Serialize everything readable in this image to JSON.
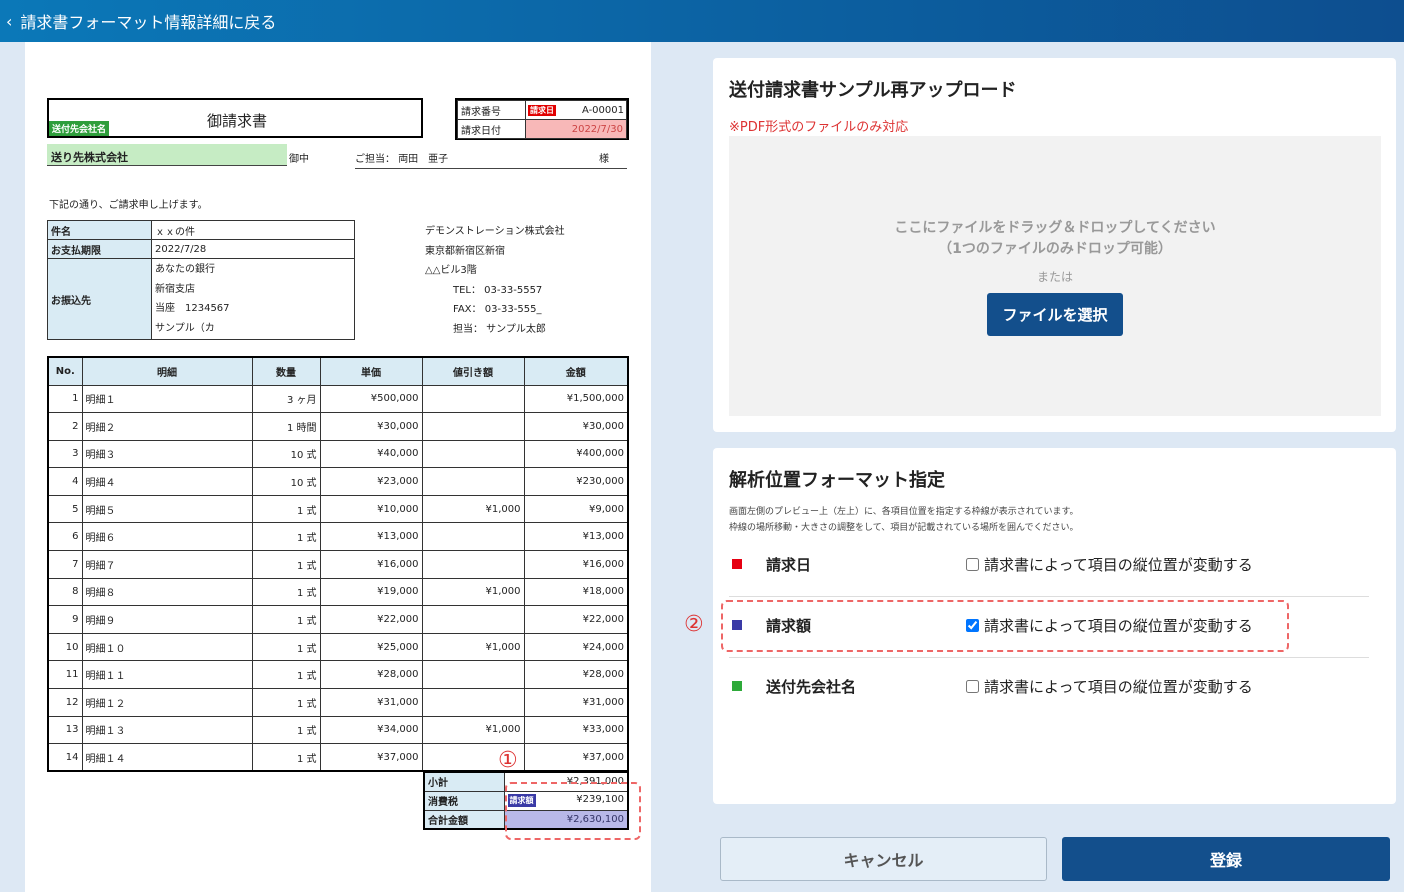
{
  "topbar": {
    "back_icon": "‹",
    "back_label": "請求書フォーマット情報詳細に戻る"
  },
  "invoice": {
    "title": "御請求書",
    "recipient_tag": "送付先会社名",
    "recipient": "送り先株式会社",
    "onchu": "御中",
    "tanto_label": "ご担当：",
    "tanto_name": "両田　亜子",
    "sama": "様",
    "meta": [
      {
        "label": "請求番号",
        "tag": "請求日",
        "value": "A-00001"
      },
      {
        "label": "請求日付",
        "value": "2022/7/30"
      }
    ],
    "greeting": "下記の通り、ご請求申し上げます。",
    "info": {
      "kenmei_label": "件名",
      "kenmei": "ｘｘの件",
      "due_label": "お支払期限",
      "due": "2022/7/28",
      "bank_label": "お振込先",
      "bank_lines": [
        "あなたの銀行",
        "新宿支店",
        "当座　1234567",
        "サンプル（カ"
      ]
    },
    "company": [
      "デモンストレーション株式会社",
      "東京都新宿区新宿",
      "△△ビル3階",
      "TEL：  03-33-5557",
      "FAX：  03-33-555_",
      "担当：  サンプル太郎"
    ],
    "headers": [
      "No.",
      "明細",
      "数量",
      "単価",
      "値引き額",
      "金額"
    ],
    "rows": [
      [
        "1",
        "明細１",
        "3 ヶ月",
        "¥500,000",
        "",
        "¥1,500,000"
      ],
      [
        "2",
        "明細２",
        "1 時間",
        "¥30,000",
        "",
        "¥30,000"
      ],
      [
        "3",
        "明細３",
        "10 式",
        "¥40,000",
        "",
        "¥400,000"
      ],
      [
        "4",
        "明細４",
        "10 式",
        "¥23,000",
        "",
        "¥230,000"
      ],
      [
        "5",
        "明細５",
        "1 式",
        "¥10,000",
        "¥1,000",
        "¥9,000"
      ],
      [
        "6",
        "明細６",
        "1 式",
        "¥13,000",
        "",
        "¥13,000"
      ],
      [
        "7",
        "明細７",
        "1 式",
        "¥16,000",
        "",
        "¥16,000"
      ],
      [
        "8",
        "明細８",
        "1 式",
        "¥19,000",
        "¥1,000",
        "¥18,000"
      ],
      [
        "9",
        "明細９",
        "1 式",
        "¥22,000",
        "",
        "¥22,000"
      ],
      [
        "10",
        "明細１０",
        "1 式",
        "¥25,000",
        "¥1,000",
        "¥24,000"
      ],
      [
        "11",
        "明細１１",
        "1 式",
        "¥28,000",
        "",
        "¥28,000"
      ],
      [
        "12",
        "明細１２",
        "1 式",
        "¥31,000",
        "",
        "¥31,000"
      ],
      [
        "13",
        "明細１３",
        "1 式",
        "¥34,000",
        "¥1,000",
        "¥33,000"
      ],
      [
        "14",
        "明細１４",
        "1 式",
        "¥37,000",
        "",
        "¥37,000"
      ]
    ],
    "subtotal_label": "小計",
    "subtotal": "¥2,391,000",
    "tax_label": "消費税",
    "tax_tag": "請求額",
    "tax": "¥239,100",
    "total_label": "合計金額",
    "total": "¥2,630,100",
    "marker1": "①"
  },
  "upload": {
    "title": "送付請求書サンプル再アップロード",
    "note": "※PDF形式のファイルのみ対応",
    "drop_line1": "ここにファイルをドラッグ＆ドロップしてください",
    "drop_line2": "（1つのファイルのみドロップ可能）",
    "or": "または",
    "select_button": "ファイルを選択"
  },
  "format": {
    "title": "解析位置フォーマット指定",
    "desc1": "画面左側のプレビュー上（左上）に、各項目位置を指定する枠線が表示されています。",
    "desc2": "枠線の場所移動・大きさの調整をして、項目が記載されている場所を囲んでください。",
    "marker2": "②",
    "fields": [
      {
        "label": "請求日",
        "color": "#e60012",
        "checked": false,
        "checkbox_label": "請求書によって項目の縦位置が変動する"
      },
      {
        "label": "請求額",
        "color": "#3a3aa6",
        "checked": true,
        "checkbox_label": "請求書によって項目の縦位置が変動する"
      },
      {
        "label": "送付先会社名",
        "color": "#2eaa3a",
        "checked": false,
        "checkbox_label": "請求書によって項目の縦位置が変動する"
      }
    ]
  },
  "actions": {
    "cancel": "キャンセル",
    "submit": "登録"
  }
}
